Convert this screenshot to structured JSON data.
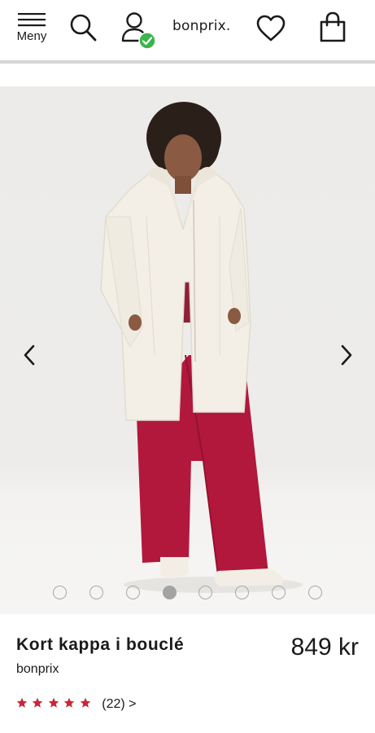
{
  "header": {
    "menu_label": "Meny",
    "logo_text": "bonprix.",
    "account_status_color": "#3bb54a"
  },
  "gallery": {
    "slide_count": 8,
    "active_slide_index": 3,
    "prev_icon": "chevron-left-icon",
    "next_icon": "chevron-right-icon"
  },
  "product": {
    "title": "Kort kappa i bouclé",
    "brand": "bonprix",
    "price": "849 kr",
    "rating": {
      "stars": 5,
      "review_count_label": "(22) >",
      "star_color": "#c62835"
    }
  }
}
